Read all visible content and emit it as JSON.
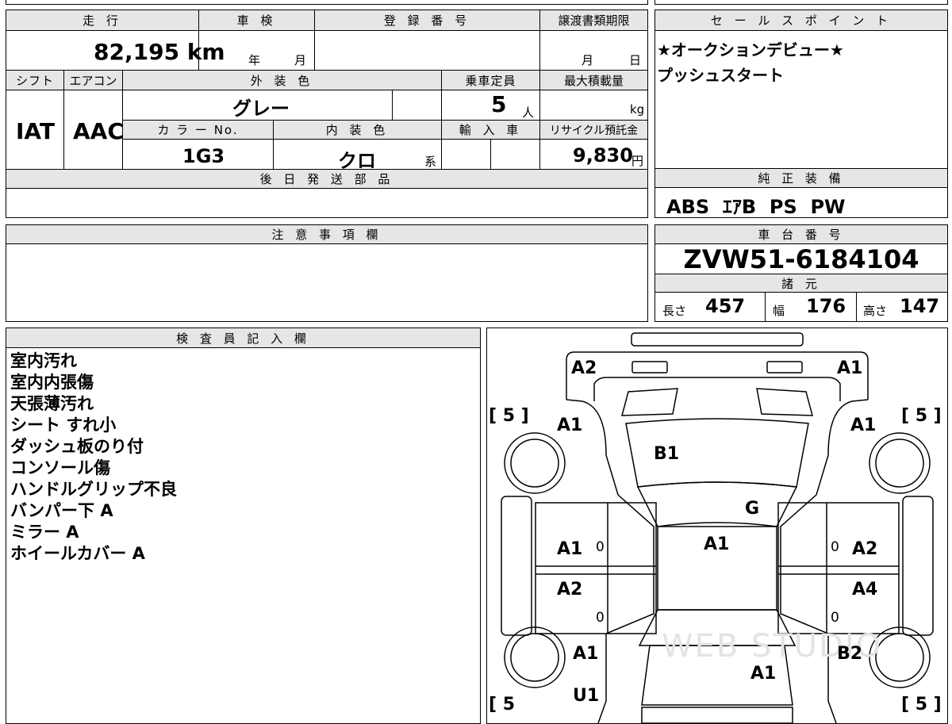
{
  "vehicle_info": {
    "mileage_label": "走 行",
    "inspection_label": "車 検",
    "registration_label": "登 録 番 号",
    "transfer_doc_label": "譲渡書類期限",
    "mileage_value": "82,195",
    "mileage_unit": "km",
    "year_unit": "年",
    "month_unit": "月",
    "transfer_month_unit": "月",
    "transfer_day_unit": "日",
    "shift_label": "シフト",
    "aircon_label": "エアコン",
    "exterior_color_label": "外 装 色",
    "capacity_label": "乗車定員",
    "max_load_label": "最大積載量",
    "shift_value": "IAT",
    "aircon_value": "AAC",
    "exterior_color_value": "グレー",
    "capacity_value": "5",
    "capacity_unit": "人",
    "max_load_unit": "kg",
    "color_no_label": "カ ラ ー No.",
    "interior_color_label": "内 装 色",
    "import_label": "輸 入 車",
    "recycle_label": "リサイクル預託金",
    "color_no_value": "1G3",
    "interior_color_value": "クロ",
    "interior_color_suffix": "系",
    "recycle_value": "9,830",
    "recycle_unit": "円",
    "later_parts_label": "後 日 発 送 部 品"
  },
  "sales_point": {
    "label": "セ ー ル ス ポ イ ン ト",
    "lines": [
      "★オークションデビュー★",
      "プッシュスタート"
    ]
  },
  "equipment": {
    "label": "純 正 装 備",
    "value": "ABS  ｴｱB  PS  PW"
  },
  "caution": {
    "label": "注 意 事 項 欄"
  },
  "chassis": {
    "label": "車 台 番 号",
    "number": "ZVW51-6184104",
    "specs_label": "諸 元",
    "length_label": "長さ",
    "length_value": "457",
    "width_label": "幅",
    "width_value": "176",
    "height_label": "高さ",
    "height_value": "147"
  },
  "inspector": {
    "label": "検 査 員 記 入 欄",
    "notes": [
      "室内汚れ",
      "室内内張傷",
      "天張薄汚れ",
      "シート すれ小",
      "ダッシュ板のり付",
      "コンソール傷",
      "ハンドルグリップ不良",
      "バンパー下 A",
      "ミラー A",
      "ホイールカバー A"
    ]
  },
  "diagram": {
    "tire_tl": "[ 5 ]",
    "tire_tr": "[ 5 ]",
    "tire_bl": "[ 5",
    "tire_br": "[ 5 ]",
    "marks": {
      "front_left_corner": "A2",
      "front_right_corner": "A1",
      "front_left_fender": "A1",
      "front_right_fender": "A1",
      "hood": "B1",
      "windshield": "G",
      "roof": "A1",
      "left_front_door": "A1",
      "left_front_door_zero": "0",
      "right_front_door_zero": "0",
      "right_front_door": "A2",
      "left_rear_door": "A2",
      "left_rear_door_zero": "0",
      "right_rear_door": "A4",
      "right_rear_door_zero": "0",
      "left_rear_fender": "A1",
      "right_rear_fender": "B2",
      "trunk": "A1",
      "left_rear_bumper": "U1"
    },
    "watermark": "WEB STUDIO"
  }
}
